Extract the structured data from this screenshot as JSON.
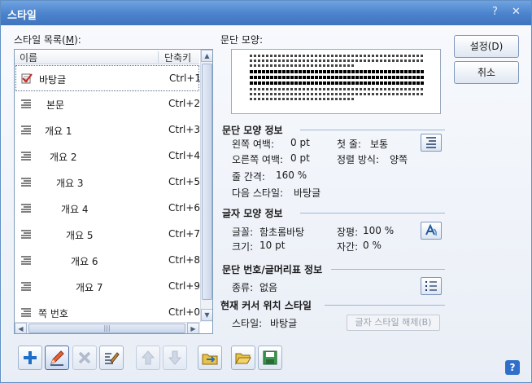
{
  "window": {
    "title": "스타일",
    "help_glyph": "?",
    "close_glyph": "✕"
  },
  "style_list": {
    "label_text": "스타일 목록(",
    "label_key": "M",
    "label_end": "):",
    "header_name": "이름",
    "header_shortcut": "단축키",
    "items": [
      {
        "name": "바탕글",
        "shortcut": "Ctrl+1",
        "icon": "checked-paragraph-icon"
      },
      {
        "name": "본문",
        "shortcut": "Ctrl+2",
        "icon": "paragraph-lines-icon"
      },
      {
        "name": "개요 1",
        "shortcut": "Ctrl+3",
        "icon": "paragraph-lines-icon"
      },
      {
        "name": "개요 2",
        "shortcut": "Ctrl+4",
        "icon": "paragraph-lines-icon"
      },
      {
        "name": "개요 3",
        "shortcut": "Ctrl+5",
        "icon": "paragraph-lines-icon"
      },
      {
        "name": "개요 4",
        "shortcut": "Ctrl+6",
        "icon": "paragraph-lines-icon"
      },
      {
        "name": "개요 5",
        "shortcut": "Ctrl+7",
        "icon": "paragraph-lines-icon"
      },
      {
        "name": "개요 6",
        "shortcut": "Ctrl+8",
        "icon": "paragraph-lines-icon"
      },
      {
        "name": "개요 7",
        "shortcut": "Ctrl+9",
        "icon": "paragraph-lines-icon"
      },
      {
        "name": "쪽 번호",
        "shortcut": "Ctrl+0",
        "icon": "paragraph-lines-icon"
      }
    ],
    "scroll_grip": "|||"
  },
  "preview": {
    "label": "문단 모양:"
  },
  "paragraph_info": {
    "title": "문단 모양 정보",
    "left_margin_label": "왼쪽 여백:",
    "left_margin_value": "0 pt",
    "right_margin_label": "오른쪽 여백:",
    "right_margin_value": "0 pt",
    "first_line_label": "첫 줄:",
    "first_line_value": "보통",
    "align_label": "정렬 방식:",
    "align_value": "양쪽",
    "line_spacing_label": "줄 간격:",
    "line_spacing_value": "160 %",
    "next_style_label": "다음 스타일:",
    "next_style_value": "바탕글"
  },
  "char_info": {
    "title": "글자 모양 정보",
    "font_label": "글꼴:",
    "font_value": "함초롬바탕",
    "size_label": "크기:",
    "size_value": "10 pt",
    "ratio_label": "장평:",
    "ratio_value": "100 %",
    "spacing_label": "자간:",
    "spacing_value": "0 %"
  },
  "numbering_info": {
    "title": "문단 번호/글머리표 정보",
    "kind_label": "종류:",
    "kind_value": "없음"
  },
  "cursor_style": {
    "title": "현재 커서 위치 스타일",
    "style_label": "스타일:",
    "style_value": "바탕글",
    "release_button": "글자 스타일 해제(B)"
  },
  "buttons": {
    "setting": "설정(D)",
    "cancel": "취소"
  },
  "colors": {
    "accent": "#4a82cc",
    "section_rule": "#9fb7d6",
    "help": "#2f6fc9"
  }
}
